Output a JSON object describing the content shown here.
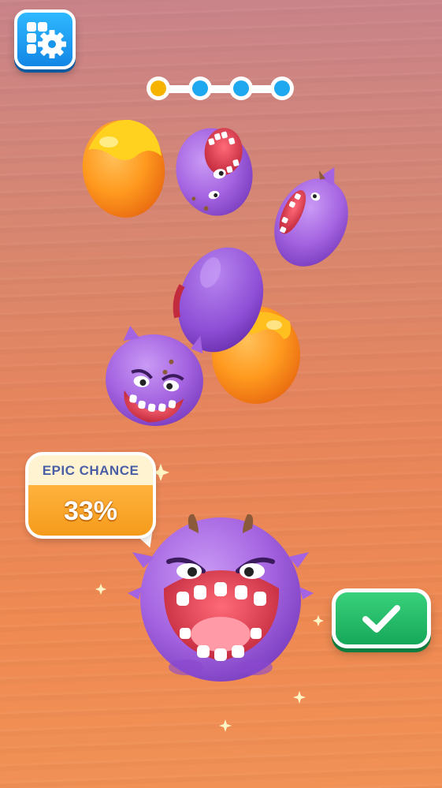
{
  "hud": {
    "settings_icon": "gear-puzzle-icon",
    "level_progress": {
      "total_steps": 4,
      "current_step": 1,
      "active_color": "#f6b400",
      "pending_color": "#1ea8f0"
    }
  },
  "epic_chance": {
    "label": "EPIC CHANCE",
    "value": "33%"
  },
  "confirm": {
    "icon": "checkmark-icon",
    "color": "#1fb865"
  },
  "colors": {
    "monster_purple": "#a463e0",
    "egg_orange": "#ff9a1f",
    "egg_yellow": "#ffd21f"
  }
}
